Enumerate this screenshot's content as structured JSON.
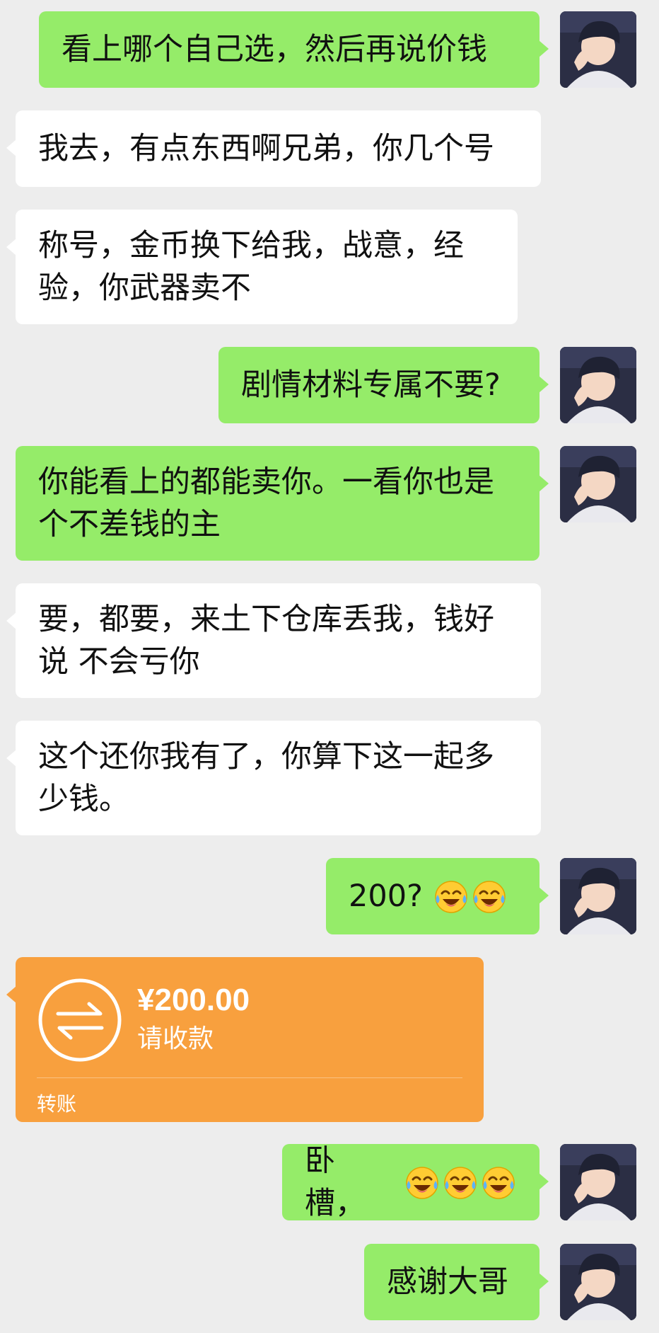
{
  "colors": {
    "background": "#ededed",
    "my_bubble": "#95ec69",
    "their_bubble": "#ffffff",
    "transfer_card": "#f8a03e"
  },
  "messages": [
    {
      "side": "me",
      "text": "看上哪个自己选，然后再说价钱",
      "emojis": 0
    },
    {
      "side": "them",
      "text": "我去，有点东西啊兄弟，你几个号",
      "emojis": 0
    },
    {
      "side": "them",
      "text": "称号，金币换下给我，战意，经\n验，你武器卖不",
      "emojis": 0
    },
    {
      "side": "me",
      "text": "剧情材料专属不要?",
      "emojis": 0
    },
    {
      "side": "me",
      "text": "你能看上的都能卖你。一看你也是\n个不差钱的主",
      "emojis": 0
    },
    {
      "side": "them",
      "text": "要，都要，来土下仓库丢我，钱好\n说 不会亏你",
      "emojis": 0
    },
    {
      "side": "them",
      "text": "这个还你我有了，你算下这一起多\n少钱。",
      "emojis": 0
    },
    {
      "side": "me",
      "text": "200?",
      "emojis": 2,
      "emoji_name": "tears-of-joy-emoji"
    },
    {
      "side": "me",
      "text": "卧槽，",
      "emojis": 3,
      "emoji_name": "tears-of-joy-emoji"
    },
    {
      "side": "me",
      "text": "感谢大哥",
      "emojis": 0
    }
  ],
  "transfer": {
    "amount": "¥200.00",
    "status": "请收款",
    "footer": "转账",
    "icon": "transfer-arrows-icon"
  },
  "avatar_icon": "user-avatar"
}
